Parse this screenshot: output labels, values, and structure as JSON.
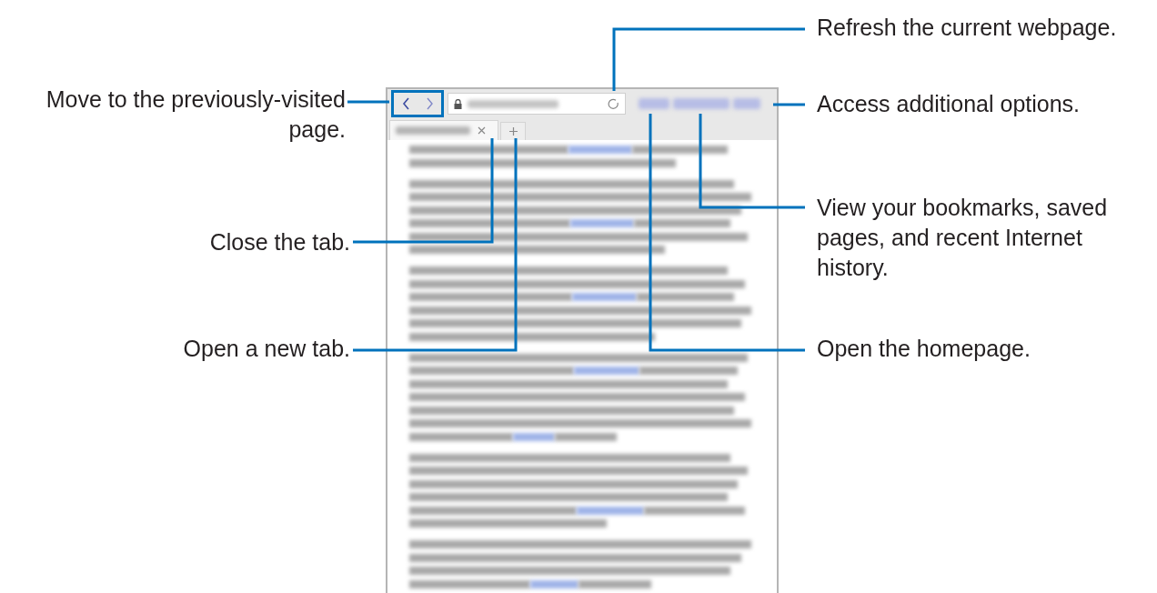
{
  "callouts": [
    {
      "lines": [
        "Move to the previously-visited",
        "page."
      ]
    },
    {
      "lines": [
        "Close the tab."
      ]
    },
    {
      "lines": [
        "Open a new tab."
      ]
    },
    {
      "lines": [
        "Refresh the current webpage."
      ]
    },
    {
      "lines": [
        "Access additional options."
      ]
    },
    {
      "lines": [
        "View your bookmarks, saved",
        "pages, and recent Internet",
        "history."
      ]
    },
    {
      "lines": [
        "Open the homepage."
      ]
    }
  ]
}
